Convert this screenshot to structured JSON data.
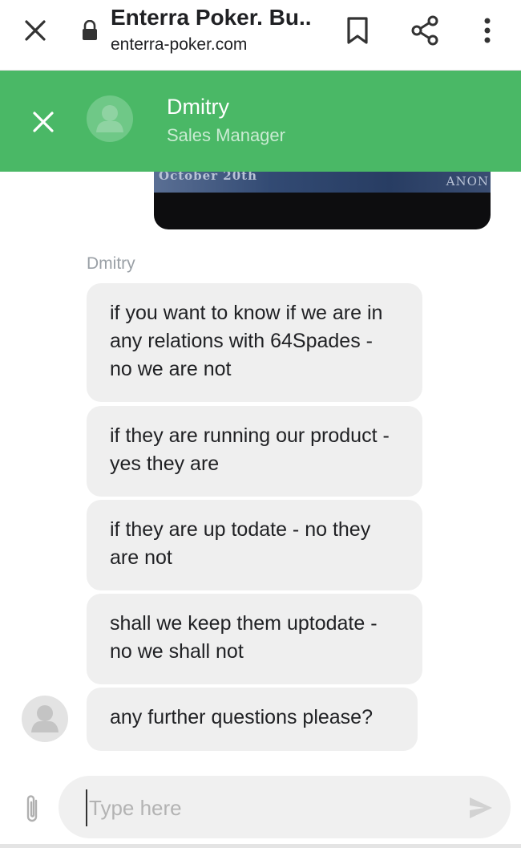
{
  "browser": {
    "title": "Enterra Poker. Bu...",
    "url": "enterra-poker.com"
  },
  "chat_header": {
    "agent_name": "Dmitry",
    "agent_role": "Sales Manager"
  },
  "attachment": {
    "caption_left": "October 20th",
    "caption_right": "ANON"
  },
  "conversation": {
    "sender": "Dmitry",
    "messages": [
      "if you want to know if we are in any relations with 64Spades - no we are not",
      "if they are running our product - yes they are",
      "if they are up todate - no they are not",
      "shall we keep them uptodate - no we shall not",
      "any further questions please?"
    ]
  },
  "composer": {
    "placeholder": "Type here"
  },
  "colors": {
    "header_green": "#4ab866",
    "bubble_bg": "#efefef"
  },
  "icons": [
    "close-icon",
    "lock-icon",
    "bookmark-icon",
    "share-icon",
    "more-vert-icon",
    "avatar-icon",
    "attach-icon",
    "send-icon"
  ]
}
